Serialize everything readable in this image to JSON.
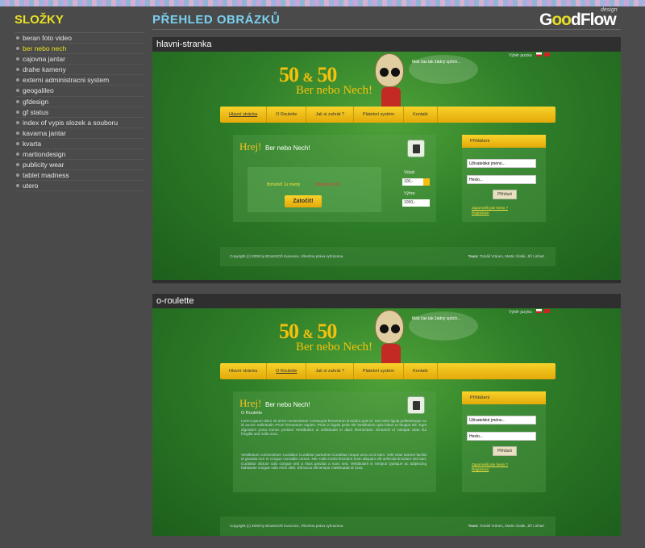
{
  "sidebar": {
    "title": "SLOŽKY",
    "items": [
      {
        "label": "beran foto video"
      },
      {
        "label": "ber nebo nech",
        "active": true
      },
      {
        "label": "cajovna jantar"
      },
      {
        "label": "drahe kameny"
      },
      {
        "label": "externi administracni system"
      },
      {
        "label": "geogalileo"
      },
      {
        "label": "gfdesign"
      },
      {
        "label": "gf status"
      },
      {
        "label": "index of vypis slozek a souboru"
      },
      {
        "label": "kavarna jantar"
      },
      {
        "label": "kvarta"
      },
      {
        "label": "martiondesign"
      },
      {
        "label": "publicity wear"
      },
      {
        "label": "tablet madness"
      },
      {
        "label": "utero"
      }
    ]
  },
  "main": {
    "title": "PŘEHLED OBRÁZKŮ"
  },
  "brand": {
    "logo_pre": "G",
    "logo_o": "oo",
    "logo_post": "dFlow",
    "logo_tag": "design"
  },
  "colors": {
    "background": "#4a4a4a",
    "sidebar_title": "#e8e024",
    "main_title": "#7ad0ee",
    "active_item": "#e8e024",
    "nav_gold": "#f6c10c",
    "site_green": "#2e7d28"
  },
  "site": {
    "logo_number": "50",
    "logo_amp": "&",
    "logo_number2": "50",
    "logo_sub": "Ber nebo Nech!",
    "cloud": "Máš čas tak žádný spěch...",
    "lang_label": "Výběr jazyka",
    "nav": [
      "Hlavní stránka",
      "O Roulette",
      "Jak si zahrát ?",
      "Platební systém",
      "Kontakt"
    ],
    "hrej": "Hrej!",
    "hrej_sub": "Ber nebo Nech!",
    "login_title": "Přihlášení",
    "login_user_placeholder": "Uživatelské jméno...",
    "login_pass_placeholder": "Heslo...",
    "login_button": "Přihlásit",
    "login_forgot": "Zapomněli jste heslo ?",
    "login_register": "Registrace",
    "footer_copy": "Copyright (c) 2009 by BGaSSOŠ Kunovice, Všechna práva vyhrazena.",
    "footer_team_label": "Team:",
    "footer_team": "Tomáš Vránen, Martin Šoták, Jiří Linhart"
  },
  "panels": [
    {
      "title": "hlavni-stranka",
      "active_nav": 0,
      "lose_text_a": "Bohužel! Ju mamý",
      "lose_text_b": "Zkuste po 90,-",
      "spin_button": "Zatočit!",
      "bet_label": "Vklad:",
      "bet_value": "100,-",
      "win_label": "Výhra:",
      "win_value": "1000,-"
    },
    {
      "title": "o-roulette",
      "active_nav": 1,
      "section": "O Roulette",
      "para1": "Lorem ipsum dolor sit amet consectetuer consequat fermentum tincidunt quis id. Sed ante ligula pellentesque ac id auctor sollicitudin Proin fermentum sapien. Proin in ligula pede elit Vestibulum quis lobus ut feugiat elit. Eget dignissim porta Donec pretium Vestibulum ut sollicitudin in diam elementum. Dictumst id volutpat vitae dui fringilla sed nulla nunc.",
      "para2": "Vestibulum consectetuer Curabitur Curabitur parturient Curabitur neque urna ut id Nam. Velit vitae laoreet facilisi id gravida non et congue convallis cursus. Nec nulla morbi tincidunt enim aliquam elit vehicula tincidunt sed sed. Curabitur dictum odio congue sed a risus gravida a nunc sed. Vestibulum in tempus Quisque ac adipiscing habitasse congue odio enim nibh. Elit lacus elit tempor malesuada id Cras."
    }
  ]
}
